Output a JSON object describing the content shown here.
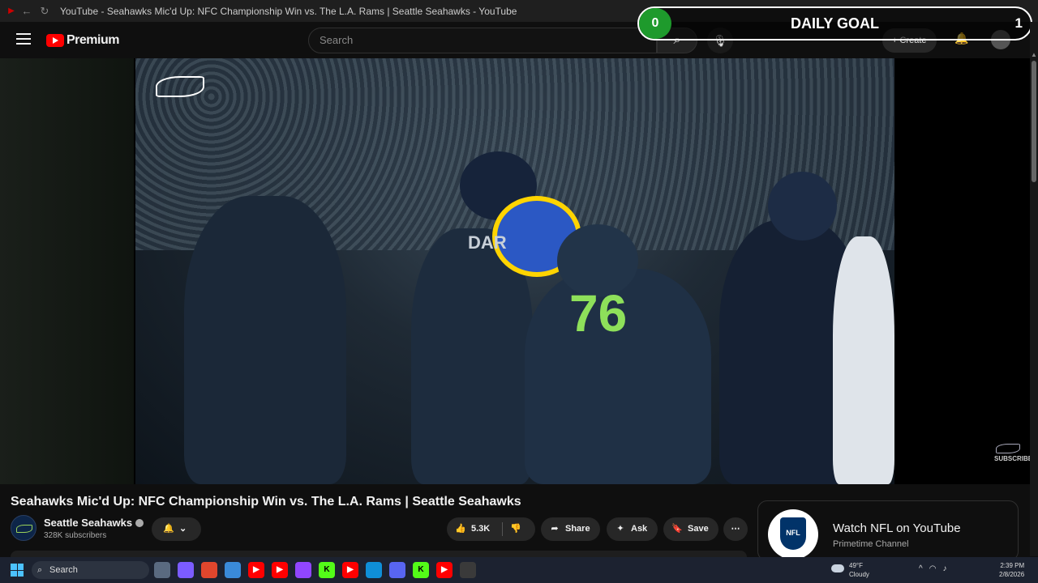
{
  "window": {
    "title": "YouTube - Seahawks Mic'd Up: NFC Championship Win vs. The L.A. Rams | Seattle Seahawks - YouTube"
  },
  "header": {
    "logo_text": "Premium",
    "search_placeholder": "Search",
    "create_label": "Create"
  },
  "daily_goal": {
    "current": "0",
    "label": "DAILY GOAL",
    "target": "1",
    "accent": "#1e9a2c"
  },
  "video": {
    "title": "Seahawks Mic'd Up: NFC Championship Win vs. The L.A. Rams | Seattle Seahawks",
    "overlay_subscribe": "SUBSCRIBE",
    "jersey_number": "76",
    "jersey_name": "DAR"
  },
  "channel": {
    "name": "Seattle Seahawks",
    "subscribers": "328K subscribers"
  },
  "actions": {
    "likes": "5.3K",
    "share": "Share",
    "ask": "Ask",
    "save": "Save"
  },
  "recommendation": {
    "title": "Watch NFL on YouTube",
    "subtitle": "Primetime Channel",
    "logo_text": "NFL"
  },
  "taskbar": {
    "search": "Search",
    "weather_temp": "49°F",
    "weather_desc": "Cloudy",
    "time": "2:39 PM",
    "date": "2/8/2026",
    "apps": [
      {
        "icon": "file-explorer-icon",
        "glyph": "",
        "color": "#5a6a80"
      },
      {
        "icon": "copilot-icon",
        "glyph": "",
        "color": "#7b5cff"
      },
      {
        "icon": "app-red-diamond-icon",
        "glyph": "",
        "color": "#e0462d"
      },
      {
        "icon": "store-icon",
        "glyph": "",
        "color": "#3a8ad9"
      },
      {
        "icon": "youtube-icon",
        "glyph": "▶",
        "color": "#ff0000"
      },
      {
        "icon": "youtube-icon",
        "glyph": "▶",
        "color": "#ff0000"
      },
      {
        "icon": "twitch-icon",
        "glyph": "",
        "color": "#9146ff"
      },
      {
        "icon": "kick-icon",
        "glyph": "K",
        "color": "#53fc18"
      },
      {
        "icon": "youtube-music-icon",
        "glyph": "▶",
        "color": "#ff0000"
      },
      {
        "icon": "edge-icon",
        "glyph": "",
        "color": "#0f8fd8"
      },
      {
        "icon": "discord-icon",
        "glyph": "",
        "color": "#5865f2"
      },
      {
        "icon": "kick-icon",
        "glyph": "K",
        "color": "#53fc18"
      },
      {
        "icon": "youtube-icon",
        "glyph": "▶",
        "color": "#ff0000"
      },
      {
        "icon": "obs-icon",
        "glyph": "",
        "color": "#3a3a3a"
      }
    ]
  }
}
